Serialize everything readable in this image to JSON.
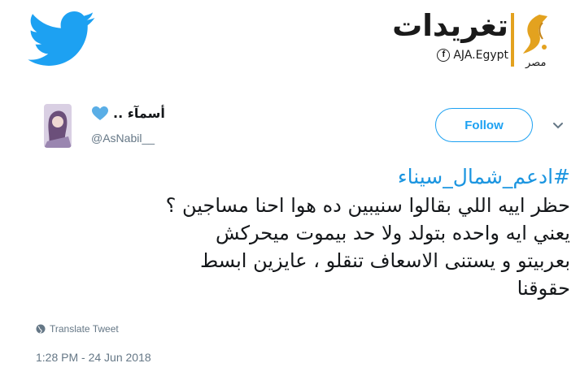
{
  "header": {
    "brand_title": "تغريدات",
    "brand_handle": "AJA.Egypt",
    "network_label": "مصر",
    "accent_color": "#e3a21f",
    "twitter_color": "#1da1f2"
  },
  "tweet": {
    "user_name": ".. أسمآء",
    "user_handle": "@AsNabil__",
    "follow_label": "Follow",
    "hashtag": "#ادعم_شمال_سيناء",
    "lines": [
      "حظر اييه اللي بقالوا سنيبين ده هوا احنا مساجين ؟",
      "يعني ايه واحده بتولد ولا حد بيموت ميحركش",
      "بعربيتو و يستنى الاسعاف تنقلو ، عايزين ابسط",
      "حقوقنا"
    ],
    "translate_label": "Translate Tweet",
    "timestamp": "1:28 PM - 24 Jun 2018"
  },
  "icons": {
    "bird": "twitter-bird-icon",
    "heart": "blue-heart-icon",
    "facebook": "facebook-icon",
    "chevron": "chevron-down-icon",
    "globe": "globe-icon"
  }
}
